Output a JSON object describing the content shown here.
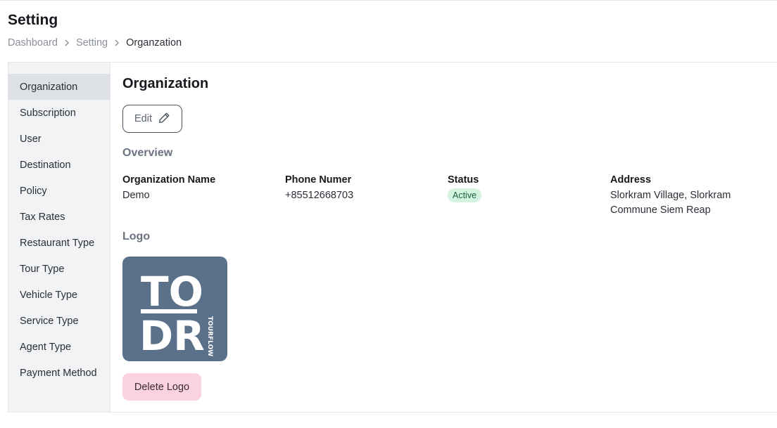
{
  "page": {
    "title": "Setting"
  },
  "breadcrumb": {
    "items": [
      "Dashboard",
      "Setting",
      "Organzation"
    ]
  },
  "sidebar": {
    "items": [
      {
        "label": "Organization",
        "active": true
      },
      {
        "label": "Subscription"
      },
      {
        "label": "User"
      },
      {
        "label": "Destination"
      },
      {
        "label": "Policy"
      },
      {
        "label": "Tax Rates"
      },
      {
        "label": "Restaurant Type"
      },
      {
        "label": "Tour Type"
      },
      {
        "label": "Vehicle Type"
      },
      {
        "label": "Service Type"
      },
      {
        "label": "Agent Type"
      },
      {
        "label": "Payment Method"
      }
    ]
  },
  "main": {
    "title": "Organization",
    "edit_label": "Edit",
    "overview_label": "Overview",
    "fields": {
      "name": {
        "label": "Organization Name",
        "value": "Demo"
      },
      "phone": {
        "label": "Phone Numer",
        "value": "+85512668703"
      },
      "status": {
        "label": "Status",
        "value": "Active"
      },
      "address": {
        "label": "Address",
        "value": "Slorkram Village, Slorkram Commune Siem Reap"
      }
    },
    "logo_label": "Logo",
    "logo": {
      "line1": "TO",
      "line2": "DR",
      "side_text": "TOURFLOW"
    },
    "delete_logo_label": "Delete Logo"
  },
  "colors": {
    "active_badge_bg": "#d4f4e2",
    "active_badge_text": "#17603a",
    "delete_button_bg": "#fbd3e0",
    "logo_bg": "#5a7189",
    "sidebar_bg": "#f1f3f5",
    "sidebar_active_bg": "#dde1e6"
  }
}
